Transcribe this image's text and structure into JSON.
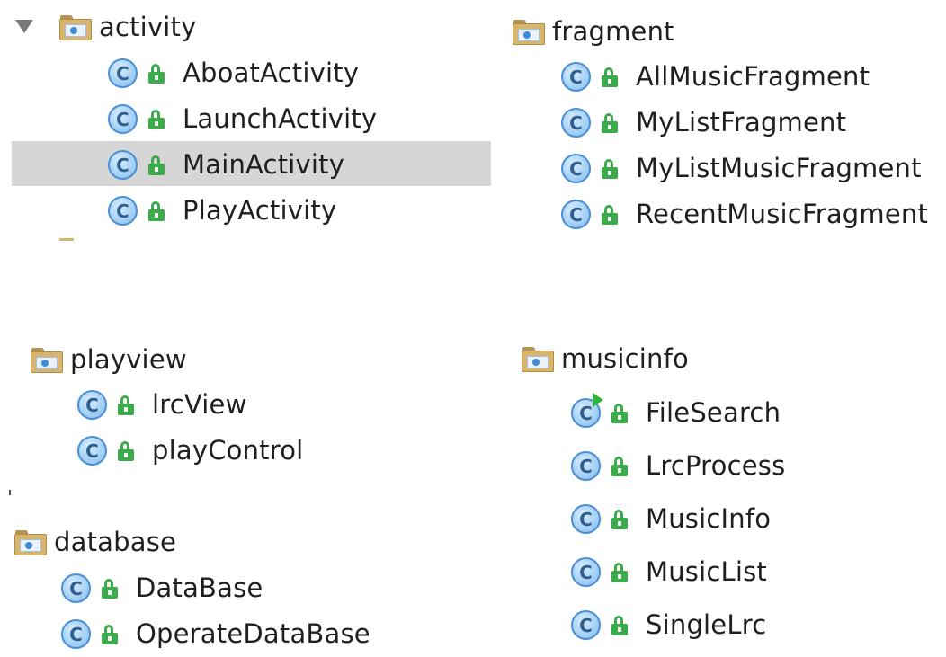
{
  "packages": {
    "activity": {
      "name": "activity",
      "classes": [
        "AboatActivity",
        "LaunchActivity",
        "MainActivity",
        "PlayActivity"
      ],
      "selected": "MainActivity"
    },
    "fragment": {
      "name": "fragment",
      "classes": [
        "AllMusicFragment",
        "MyListFragment",
        "MyListMusicFragment",
        "RecentMusicFragment"
      ]
    },
    "playview": {
      "name": "playview",
      "classes": [
        "lrcView",
        "playControl"
      ]
    },
    "database": {
      "name": "database",
      "classes": [
        "DataBase",
        "OperateDataBase"
      ]
    },
    "musicinfo": {
      "name": "musicinfo",
      "classes": [
        "FileSearch",
        "LrcProcess",
        "MusicInfo",
        "MusicList",
        "SingleLrc"
      ]
    }
  },
  "icons": {
    "folder": "package-folder-icon",
    "class": "class-c-icon",
    "access": "unlocked-public-icon",
    "runnable": "run-arrow-icon",
    "expand": "expand-caret-icon"
  },
  "colors": {
    "folder": "#d7b56e",
    "class_icon": "#9fcdf4",
    "lock": "#3cab4c",
    "selection": "#d6d6d6"
  }
}
